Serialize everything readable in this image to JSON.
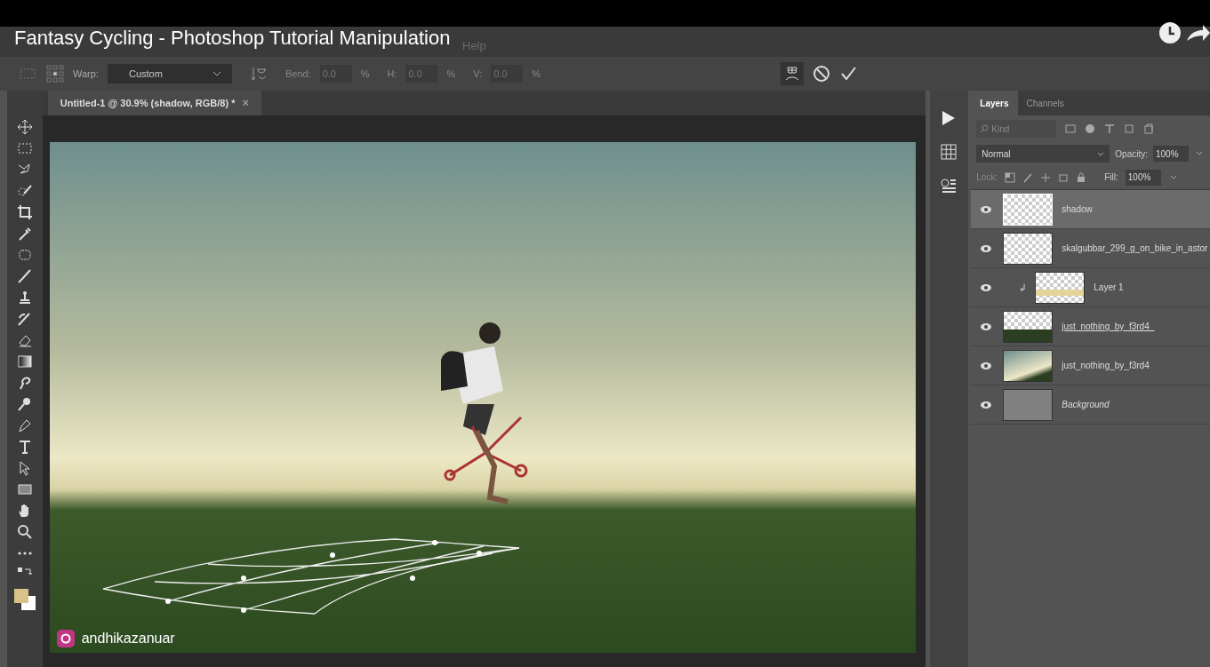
{
  "video_title": "Fantasy Cycling - Photoshop Tutorial Manipulation",
  "menu_bar": {
    "items": [
      "Help"
    ]
  },
  "options_bar": {
    "warp_label": "Warp:",
    "warp_value": "Custom",
    "bend_label": "Bend:",
    "bend_value": "0.0",
    "bend_unit": "%",
    "h_label": "H:",
    "h_value": "0.0",
    "h_unit": "%",
    "v_label": "V:",
    "v_value": "0.0",
    "v_unit": "%"
  },
  "document_tab": {
    "title": "Untitled-1 @ 30.9% (shadow, RGB/8) *",
    "close": "×"
  },
  "panel_tabs": [
    {
      "label": "Layers",
      "selected": true
    },
    {
      "label": "Channels",
      "selected": false
    }
  ],
  "layers_panel": {
    "filter_placeholder": "Kind",
    "blend_mode": "Normal",
    "opacity_label": "Opacity:",
    "opacity": "100%",
    "lock_label": "Lock:",
    "fill_label": "Fill:",
    "fill": "100%"
  },
  "layers": [
    {
      "name": "shadow",
      "selected": true,
      "visible": true,
      "clipped": false,
      "italic": false,
      "underlined": false,
      "kind": "transparent"
    },
    {
      "name": "skalgubbar_299_g_on_bike_in_astor",
      "selected": false,
      "visible": true,
      "clipped": false,
      "italic": false,
      "underlined": false,
      "kind": "figure"
    },
    {
      "name": "Layer 1",
      "selected": false,
      "visible": true,
      "clipped": true,
      "italic": false,
      "underlined": false,
      "kind": "glow"
    },
    {
      "name": "just_nothing_by_f3rd4_",
      "selected": false,
      "visible": true,
      "clipped": false,
      "italic": false,
      "underlined": true,
      "kind": "grass"
    },
    {
      "name": "just_nothing_by_f3rd4",
      "selected": false,
      "visible": true,
      "clipped": false,
      "italic": false,
      "underlined": false,
      "kind": "scene"
    },
    {
      "name": "Background",
      "selected": false,
      "visible": true,
      "clipped": false,
      "italic": true,
      "underlined": false,
      "kind": "gray"
    }
  ],
  "channel_handle": "andhikazanuar"
}
